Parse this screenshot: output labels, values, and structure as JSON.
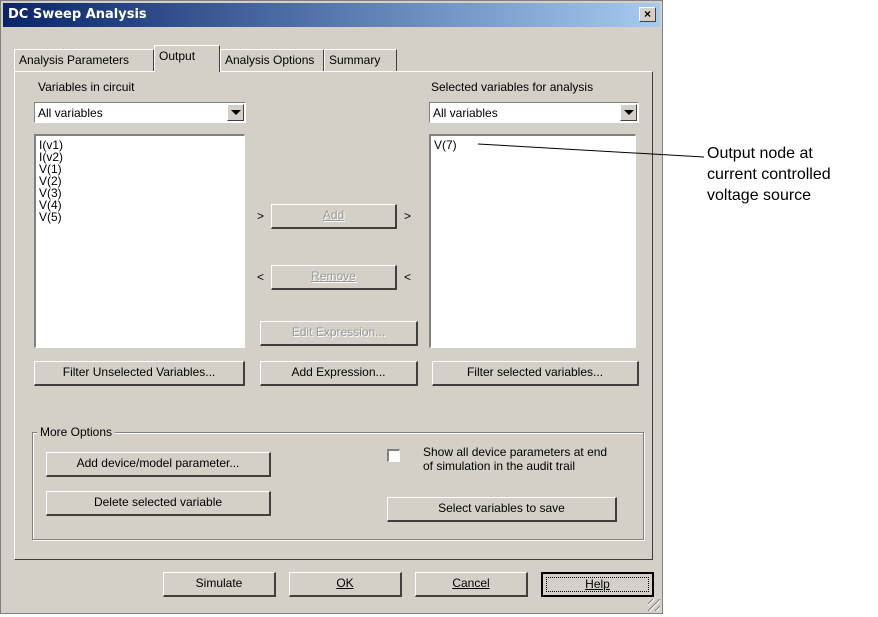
{
  "window": {
    "title": "DC Sweep Analysis",
    "close_glyph": "×"
  },
  "tabs": [
    {
      "label": "Analysis Parameters",
      "active": false
    },
    {
      "label": "Output",
      "active": true
    },
    {
      "label": "Analysis Options",
      "active": false
    },
    {
      "label": "Summary",
      "active": false
    }
  ],
  "left": {
    "label": "Variables in circuit",
    "filter_value": "All variables",
    "items": [
      "I(v1)",
      "I(v2)",
      "V(1)",
      "V(2)",
      "V(3)",
      "V(4)",
      "V(5)"
    ],
    "filter_button": "Filter Unselected Variables..."
  },
  "middle": {
    "add_label": "Add",
    "remove_label": "Remove",
    "edit_expression_label": "Edit Expression...",
    "add_expression_label": "Add Expression...",
    "arrow_right": ">",
    "arrow_left": "<"
  },
  "right": {
    "label": "Selected variables for analysis",
    "filter_value": "All variables",
    "items": [
      "V(7)"
    ],
    "filter_button": "Filter selected variables..."
  },
  "more_options": {
    "title": "More Options",
    "add_param_button": "Add device/model parameter...",
    "delete_button": "Delete selected variable",
    "show_params_line1": "Show all device parameters at end",
    "show_params_line2": "of simulation in the audit trail",
    "show_params_checked": false,
    "select_save_button": "Select variables to save"
  },
  "footer": {
    "simulate": "Simulate",
    "ok": "OK",
    "cancel": "Cancel",
    "help": "Help"
  },
  "annotation": {
    "line1": "Output node at",
    "line2": "current controlled",
    "line3": "voltage source"
  }
}
